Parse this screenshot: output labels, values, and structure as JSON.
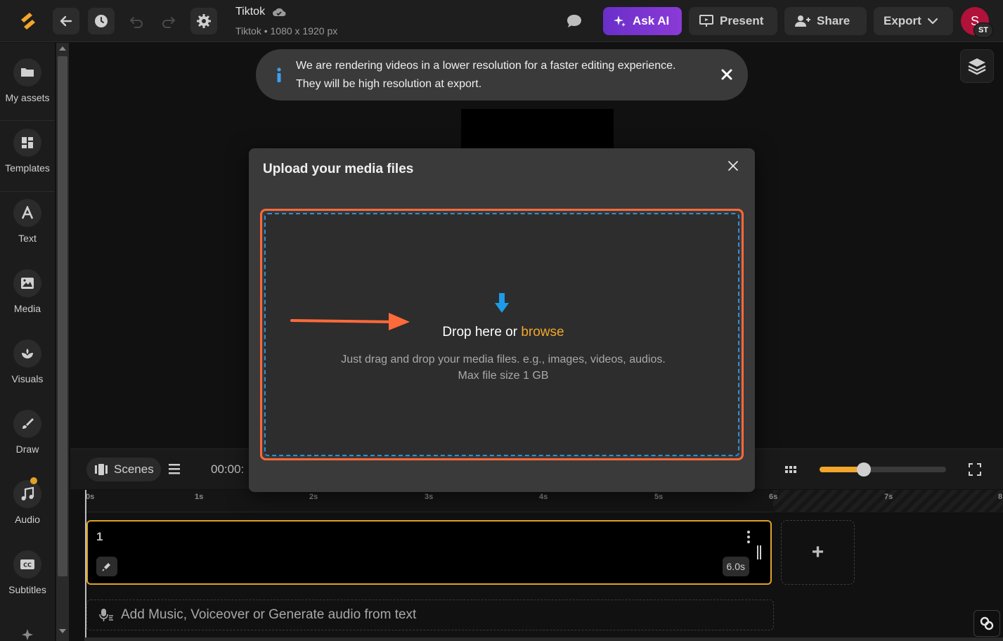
{
  "topbar": {
    "title": "Tiktok",
    "subtitle": "Tiktok • 1080 x 1920 px",
    "ask_ai_label": "Ask AI",
    "present_label": "Present",
    "share_label": "Share",
    "export_label": "Export",
    "avatar_initial": "S",
    "avatar_badge": "ST"
  },
  "sidebar": {
    "items": [
      {
        "label": "My assets",
        "icon": "folder-icon"
      },
      {
        "label": "Templates",
        "icon": "templates-icon"
      },
      {
        "label": "Text",
        "icon": "text-icon"
      },
      {
        "label": "Media",
        "icon": "image-icon"
      },
      {
        "label": "Visuals",
        "icon": "visuals-icon"
      },
      {
        "label": "Draw",
        "icon": "brush-icon"
      },
      {
        "label": "Audio",
        "icon": "music-icon"
      },
      {
        "label": "Subtitles",
        "icon": "cc-icon"
      }
    ]
  },
  "banner": {
    "text": "We are rendering videos in a lower resolution for a faster editing experience. They will be high resolution at export."
  },
  "modal": {
    "title": "Upload your media files",
    "drop_text": "Drop here or ",
    "browse_label": "browse",
    "help_line1": "Just drag and drop your media files. e.g., images, videos, audios.",
    "help_line2": "Max file size 1 GB"
  },
  "timeline": {
    "scenes_label": "Scenes",
    "time_display": "00:00:",
    "ticks": [
      "0s",
      "1s",
      "2s",
      "3s",
      "4s",
      "5s",
      "6s",
      "7s",
      "8"
    ],
    "zoom_level": 0.35,
    "scene": {
      "number": "1",
      "duration": "6.0s"
    },
    "add_scene_label": "+",
    "audio_track_label": "Add Music, Voiceover or Generate audio from text"
  },
  "colors": {
    "accent_orange": "#f2a62b",
    "annotation_red": "#ff6a3a",
    "dashed_blue": "#2e8fd6",
    "ask_ai_purple": "#7b33d0"
  }
}
